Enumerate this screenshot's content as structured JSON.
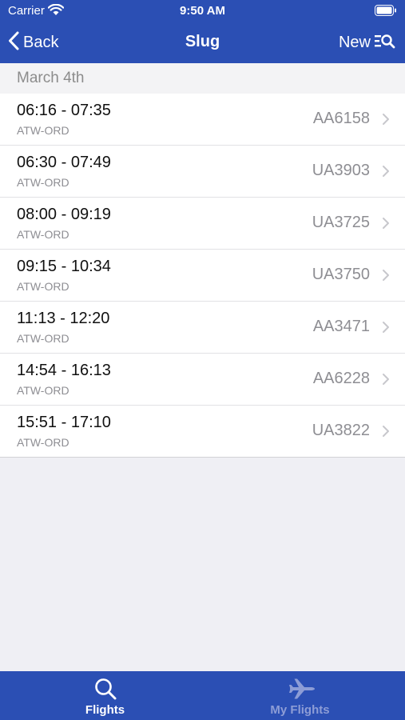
{
  "status_bar": {
    "carrier": "Carrier",
    "time": "9:50 AM"
  },
  "nav": {
    "back_label": "Back",
    "title": "Slug",
    "new_label": "New"
  },
  "section": {
    "date": "March 4th"
  },
  "flights": [
    {
      "time": "06:16 - 07:35",
      "route": "ATW-ORD",
      "flight": "AA6158"
    },
    {
      "time": "06:30 - 07:49",
      "route": "ATW-ORD",
      "flight": "UA3903"
    },
    {
      "time": "08:00 - 09:19",
      "route": "ATW-ORD",
      "flight": "UA3725"
    },
    {
      "time": "09:15 - 10:34",
      "route": "ATW-ORD",
      "flight": "UA3750"
    },
    {
      "time": "11:13 - 12:20",
      "route": "ATW-ORD",
      "flight": "AA3471"
    },
    {
      "time": "14:54 - 16:13",
      "route": "ATW-ORD",
      "flight": "AA6228"
    },
    {
      "time": "15:51 - 17:10",
      "route": "ATW-ORD",
      "flight": "UA3822"
    }
  ],
  "tabs": [
    {
      "label": "Flights",
      "icon": "search-icon",
      "active": true
    },
    {
      "label": "My Flights",
      "icon": "airplane-icon",
      "active": false
    }
  ],
  "colors": {
    "brand": "#2b4fb4",
    "background": "#efeff4",
    "secondary_text": "#8e8e93",
    "inactive_tab": "#8d9dd6"
  }
}
